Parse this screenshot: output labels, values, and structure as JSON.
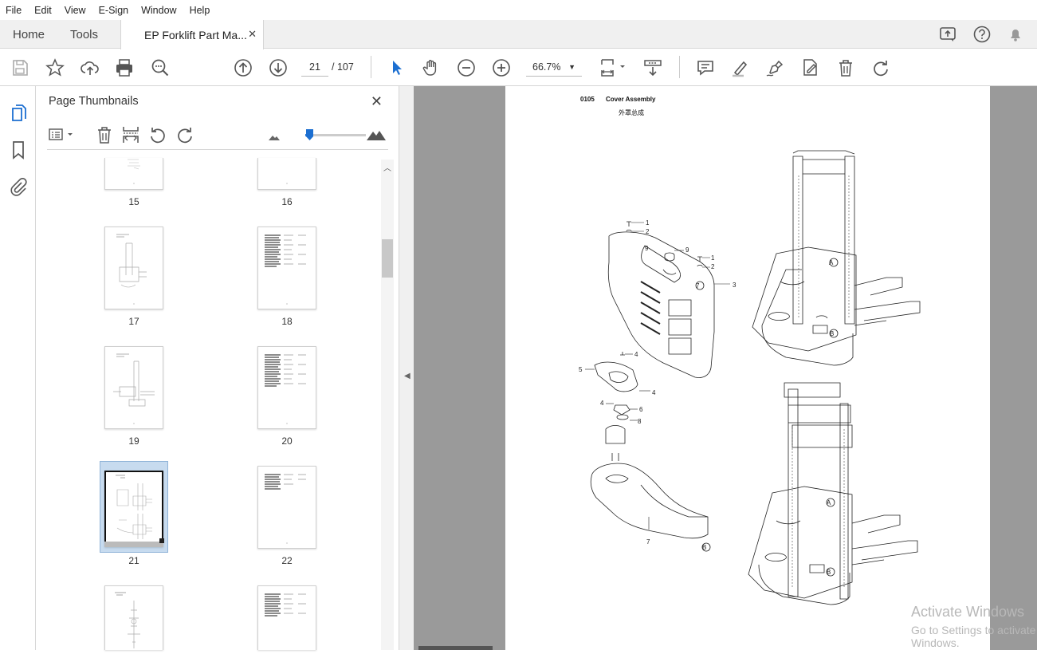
{
  "menu": [
    "File",
    "Edit",
    "View",
    "E-Sign",
    "Window",
    "Help"
  ],
  "tabs": {
    "home": "Home",
    "tools": "Tools",
    "document": "EP Forklift Part Ma...",
    "close": "✕"
  },
  "toolbar": {
    "current_page": "21",
    "page_separator": "/ 107",
    "zoom": "66.7%"
  },
  "panel": {
    "title": "Page Thumbnails",
    "close": "✕",
    "thumbnail_size_fraction": 0.05
  },
  "thumbnails": [
    {
      "label": "15"
    },
    {
      "label": "16"
    },
    {
      "label": "17"
    },
    {
      "label": "18"
    },
    {
      "label": "19"
    },
    {
      "label": "20"
    },
    {
      "label": "21",
      "selected": true
    },
    {
      "label": "22"
    },
    {
      "label": ""
    },
    {
      "label": ""
    }
  ],
  "document_page": {
    "section_number": "0105",
    "section_title": "Cover Assembly",
    "section_title_cn": "外罩总成",
    "callouts": [
      "1",
      "2",
      "9",
      "1",
      "2",
      "3",
      "4",
      "5",
      "4",
      "4",
      "6",
      "8",
      "7",
      "A",
      "B",
      "A",
      "B",
      "B"
    ]
  },
  "watermark": {
    "line1": "Activate Windows",
    "line2": "Go to Settings to activate Windows."
  }
}
